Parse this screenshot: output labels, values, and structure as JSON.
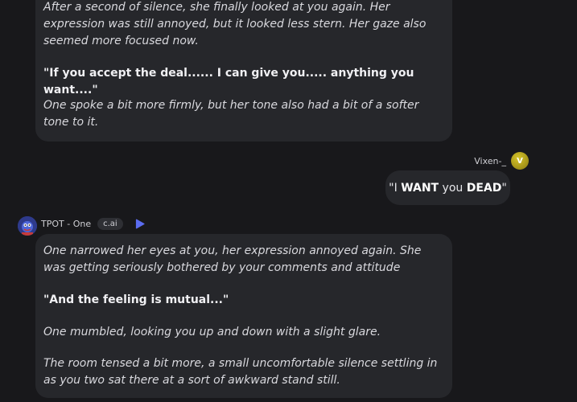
{
  "messages": {
    "prev_bot": {
      "narration_1": "After a second of silence, she finally looked at you again.  Her expression was still annoyed, but it looked less stern. Her gaze also seemed more focused now.",
      "speech": "\"If you accept the deal...... I can give you..... anything you want....\"",
      "narration_2": "One spoke a bit more firmly, but her tone also had a bit of a softer tone to it."
    },
    "user": {
      "name": "Vixen-_",
      "avatar_letter": "V",
      "quote_open": "\"I ",
      "word_1": "WANT",
      "word_2": " you ",
      "word_3": "DEAD",
      "quote_close": "\""
    },
    "bot": {
      "name": "TPOT - One",
      "tag": "c.ai",
      "narration_1": "One narrowed her eyes at you, her expression annoyed again. She was getting seriously bothered by your comments and attitude",
      "speech": "\"And the feeling is mutual...\"",
      "narration_2": "One mumbled, looking you up and down with a slight glare.",
      "narration_3": "The room tensed a bit more, a small uncomfortable silence settling in as you two sat there at a sort of awkward stand still."
    }
  },
  "icons": {
    "play": "play-icon",
    "accent": "#5b6cf0"
  }
}
